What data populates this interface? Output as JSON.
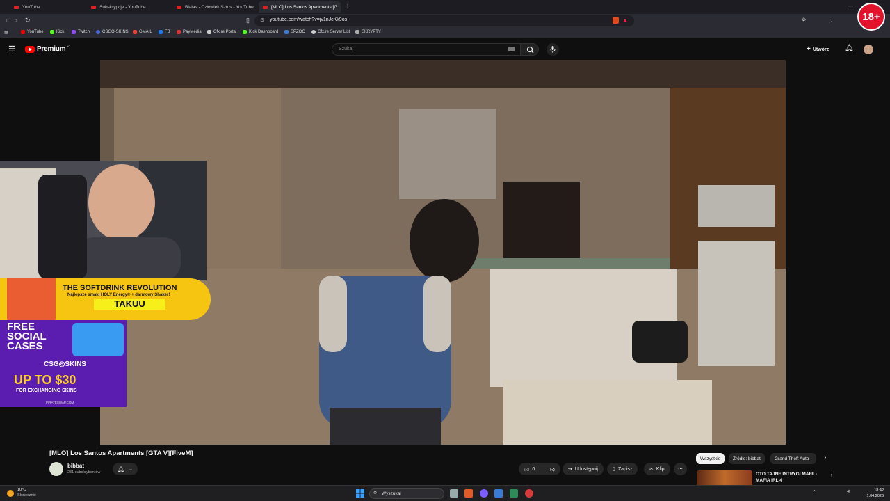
{
  "browser": {
    "tabs": [
      {
        "label": "YouTube",
        "active": false
      },
      {
        "label": "Subskrypcje - YouTube",
        "active": false
      },
      {
        "label": "Białas - Człowiek Sztos - YouTube",
        "active": false
      },
      {
        "label": "[MLO] Los Santos Apartments [G",
        "active": true
      }
    ],
    "url": "youtube.com/watch?v=jv1nJcKk9os",
    "bookmarks": [
      "YouTube",
      "Kick",
      "Twitch",
      "CSGO-SKINS",
      "GMAIL",
      "FB",
      "PayMedia",
      "Cfx.re Portal",
      "Kick Dashboard",
      "SPZOO",
      "Cfx.re Server List",
      "SKRYPTY"
    ]
  },
  "youtube": {
    "logo_text": "Premium",
    "logo_region": "PL",
    "search_placeholder": "Szukaj",
    "create_label": "Utwórz"
  },
  "age_badge": "18+",
  "overlay": {
    "banner_title": "THE SOFTDRINK REVOLUTION",
    "banner_sub": "Najlepsze smaki HOLY Energy® + darmowy Shaker!",
    "banner_brand": "TAKUU",
    "ad_free": "FREE SOCIAL CASES",
    "ad_brand": "CSG◎SKINS",
    "ad_amount": "UP TO $30",
    "ad_desc": "FOR EXCHANGING SKINS",
    "ad_site": "PIRATESWAP.COM"
  },
  "video": {
    "title": "[MLO] Los Santos Apartments [GTA V][FiveM]",
    "channel": "bibbat",
    "subscribers": "231 subskrybentów",
    "likes": "0",
    "share_label": "Udostępnij",
    "save_label": "Zapisz",
    "clip_label": "Klip"
  },
  "chips": [
    "Wszystkie",
    "Źródło: bibbat",
    "Grand Theft Auto"
  ],
  "recommended": {
    "title": "OTO TAJNE INTRYGI MAFII - MAFIA IRL 4"
  },
  "taskbar": {
    "temp": "10°C",
    "weather": "Słonecznie",
    "search_label": "Wyszukaj",
    "time": "18:42",
    "date": "1.04.2026"
  }
}
